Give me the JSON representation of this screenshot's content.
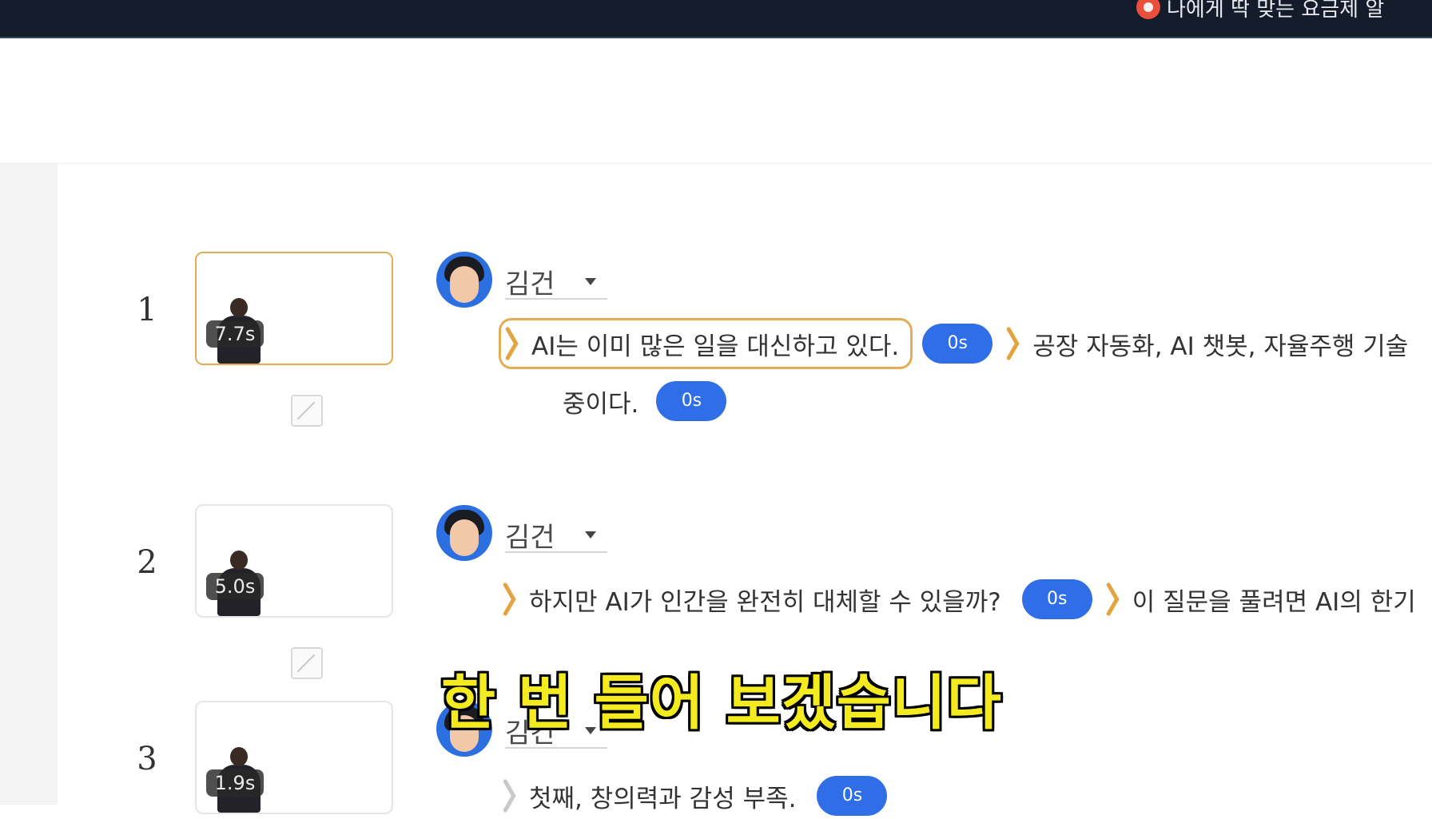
{
  "topbar": {
    "promo_text": "나에게 딱 맞는 요금제 알",
    "promo_icon": "search-icon"
  },
  "rows": [
    {
      "number": "1",
      "duration": "7.7s",
      "speaker": "김건",
      "segment1": "AI는 이미 많은 일을 대신하고 있다.",
      "pause1": "0s",
      "segment2": "공장 자동화, AI 챗봇, 자율주행 기술",
      "segment3": "중이다.",
      "pause2": "0s"
    },
    {
      "number": "2",
      "duration": "5.0s",
      "speaker": "김건",
      "segment1": "하지만 AI가 인간을 완전히 대체할 수 있을까?",
      "pause1": "0s",
      "segment2": "이 질문을 풀려면 AI의 한기"
    },
    {
      "number": "3",
      "duration": "1.9s",
      "speaker": "김건",
      "segment1": "첫째, 창의력과 감성 부족.",
      "pause1": "0s"
    }
  ],
  "subtitle": "한 번 들어 보겠습니다",
  "colors": {
    "topbar": "#141c2c",
    "accent_orange": "#e2ad55",
    "pill_blue": "#2f6ee6",
    "subtitle_yellow": "#f4ea20"
  }
}
